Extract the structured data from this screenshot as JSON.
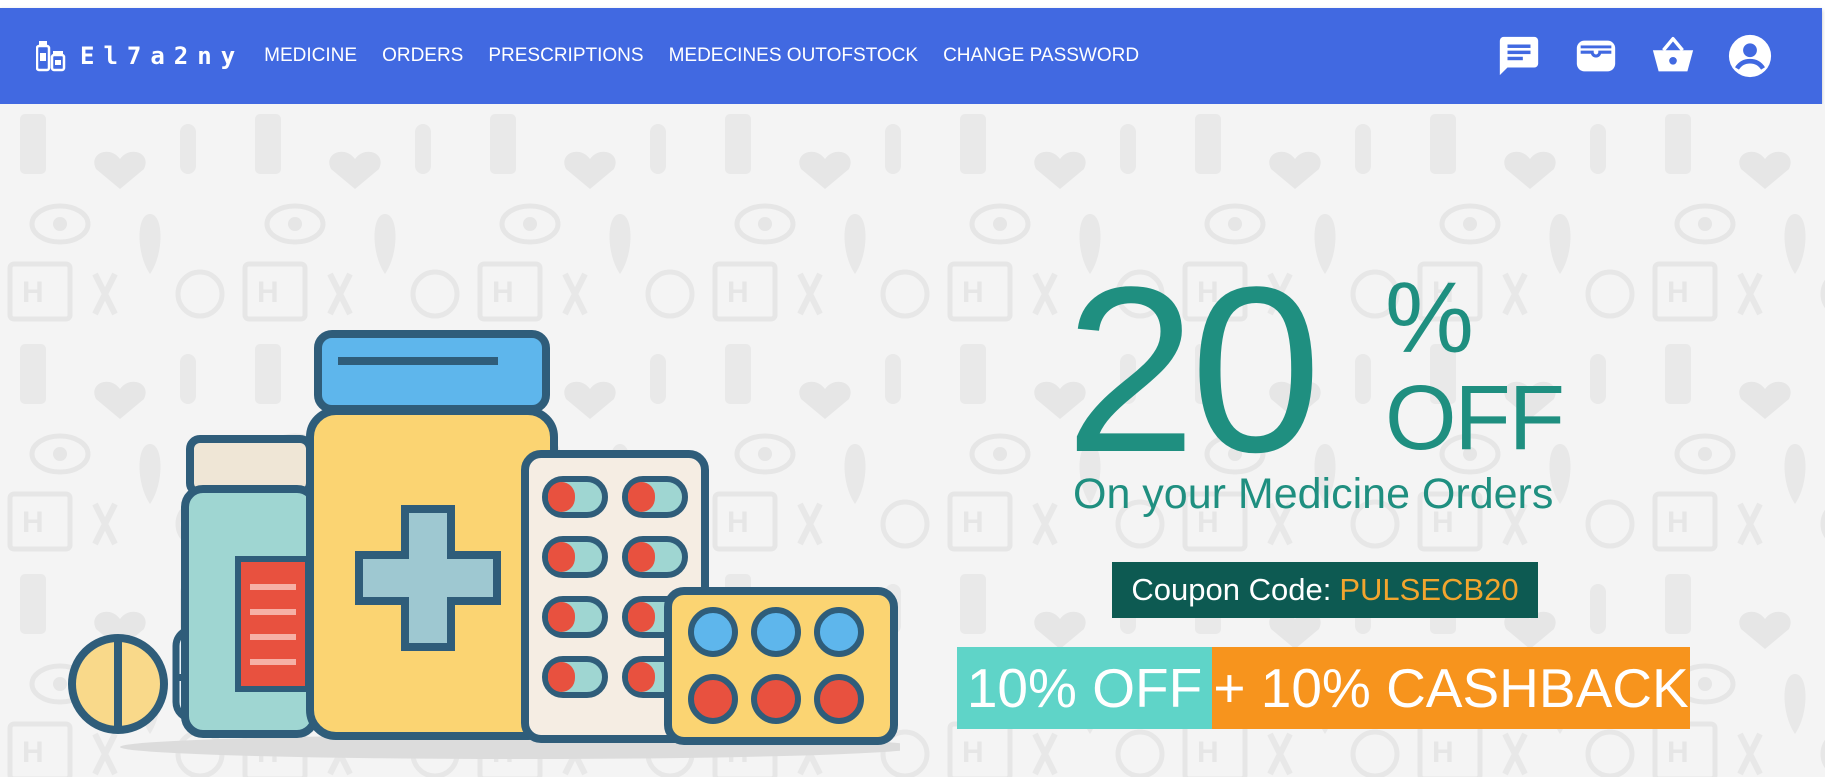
{
  "app": {
    "brand": "El7a2ny",
    "brand_icon": "medicine-bottles-icon"
  },
  "nav": {
    "links": [
      "MEDICINE",
      "ORDERS",
      "PRESCRIPTIONS",
      "MEDECINES OUTOFSTOCK",
      "CHANGE PASSWORD"
    ],
    "icons": [
      "chat-icon",
      "wallet-icon",
      "basket-icon",
      "account-icon"
    ]
  },
  "banner": {
    "discount_number": "20",
    "discount_percent": "%",
    "discount_off": "OFF",
    "subtitle": "On your Medicine Orders",
    "coupon_label": "Coupon Code:",
    "coupon_code": "PULSECB20",
    "offer_left": "10% OFF",
    "offer_right": "+ 10% CASHBACK"
  },
  "colors": {
    "navbar": "#4169e1",
    "teal": "#1f8f80",
    "coupon_bg": "#0d5a52",
    "coupon_code": "#f2a52e",
    "offer_left_bg": "#5fd4c8",
    "offer_right_bg": "#f7941d"
  }
}
